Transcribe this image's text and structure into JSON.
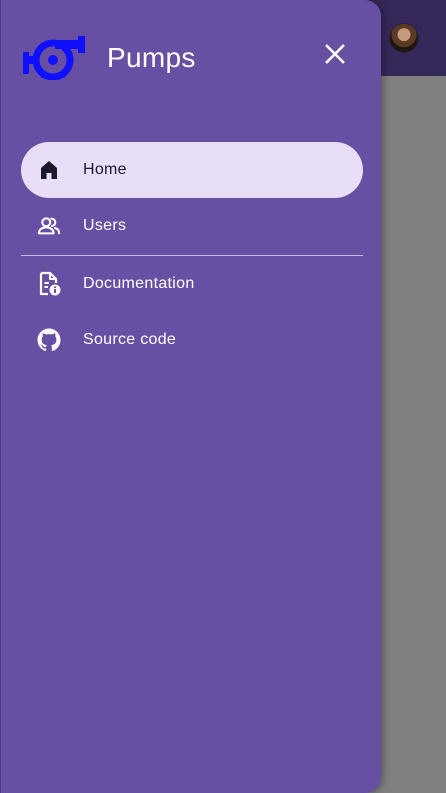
{
  "app": {
    "title": "Pumps"
  },
  "drawer": {
    "close_icon": "close-icon",
    "logo_icon": "pump-logo-icon",
    "items": [
      {
        "label": "Home",
        "icon": "home-icon",
        "active": true
      },
      {
        "label": "Users",
        "icon": "users-icon",
        "active": false
      },
      {
        "label": "Documentation",
        "icon": "document-info-icon",
        "active": false
      },
      {
        "label": "Source code",
        "icon": "github-icon",
        "active": false
      }
    ]
  },
  "appbar": {
    "avatar_icon": "user-avatar"
  },
  "colors": {
    "drawer_bg": "#6750a4",
    "active_item_bg": "#e8def8",
    "appbar_bg": "#36285a",
    "scrim_bg": "#808080",
    "logo": "#1010ff"
  }
}
